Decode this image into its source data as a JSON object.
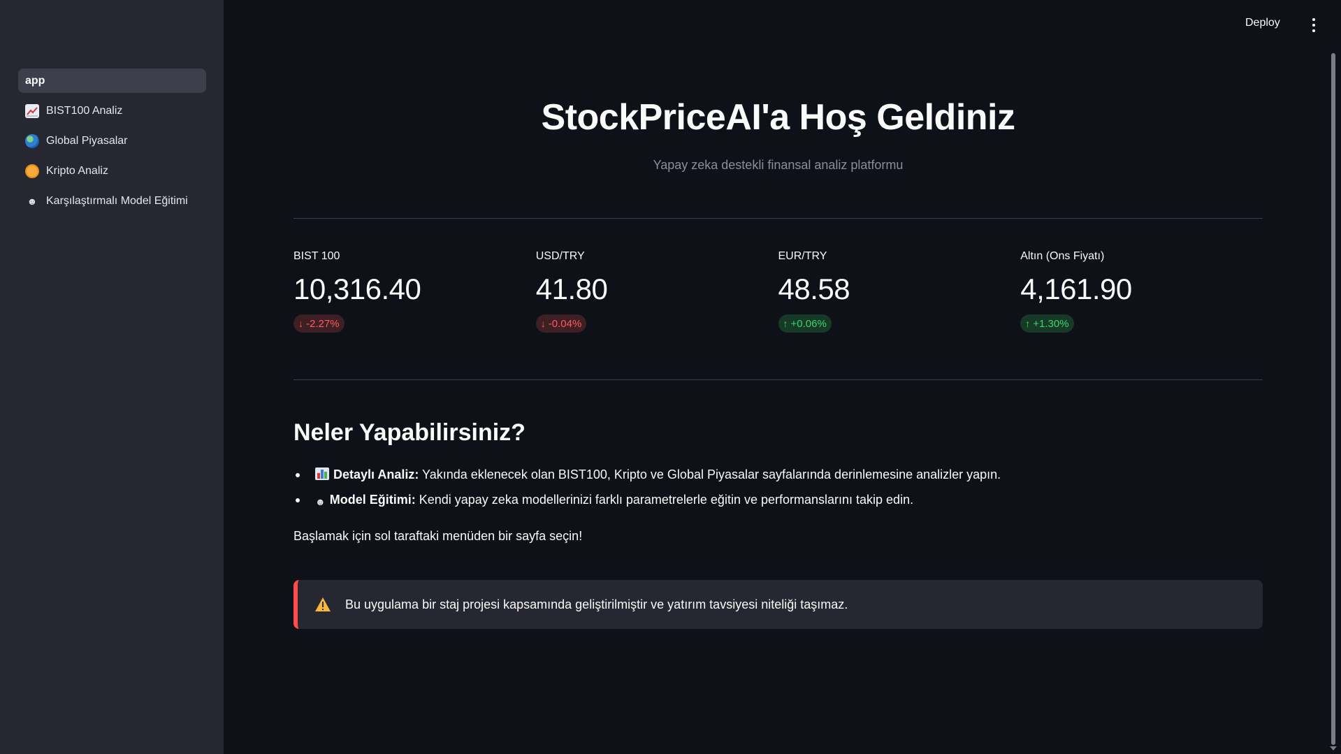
{
  "header": {
    "deploy_label": "Deploy"
  },
  "sidebar": {
    "items": [
      {
        "label": "app",
        "icon": "none",
        "active": true
      },
      {
        "label": "BIST100 Analiz",
        "icon": "chart-increasing-icon"
      },
      {
        "label": "Global Piyasalar",
        "icon": "globe-icon"
      },
      {
        "label": "Kripto Analiz",
        "icon": "coin-icon"
      },
      {
        "label": "Karşılaştırmalı Model Eğitimi",
        "icon": "brain-icon"
      }
    ]
  },
  "main": {
    "title": "StockPriceAI'a Hoş Geldiniz",
    "subtitle": "Yapay zeka destekli finansal analiz platformu",
    "metrics": [
      {
        "label": "BIST 100",
        "value": "10,316.40",
        "delta": "-2.27%",
        "direction": "down"
      },
      {
        "label": "USD/TRY",
        "value": "41.80",
        "delta": "-0.04%",
        "direction": "down"
      },
      {
        "label": "EUR/TRY",
        "value": "48.58",
        "delta": "+0.06%",
        "direction": "up"
      },
      {
        "label": "Altın (Ons Fiyatı)",
        "value": "4,161.90",
        "delta": "+1.30%",
        "direction": "up"
      }
    ],
    "section_title": "Neler Yapabilirsiniz?",
    "features": [
      {
        "title": "Detaylı Analiz:",
        "text": " Yakında eklenecek olan BIST100, Kripto ve Global Piyasalar sayfalarında derinlemesine analizler yapın."
      },
      {
        "title": "Model Eğitimi:",
        "text": " Kendi yapay zeka modellerinizi farklı parametrelerle eğitin ve performanslarını takip edin."
      }
    ],
    "start_text": "Başlamak için sol taraftaki menüden bir sayfa seçin!",
    "warning": "Bu uygulama bir staj projesi kapsamında geliştirilmiştir ve yatırım tavsiyesi niteliği taşımaz."
  },
  "colors": {
    "background": "#0e1117",
    "sidebar": "#262730",
    "negative": "#ff5a5f",
    "positive": "#3dd56d",
    "warning_border": "#ff4b4b"
  }
}
